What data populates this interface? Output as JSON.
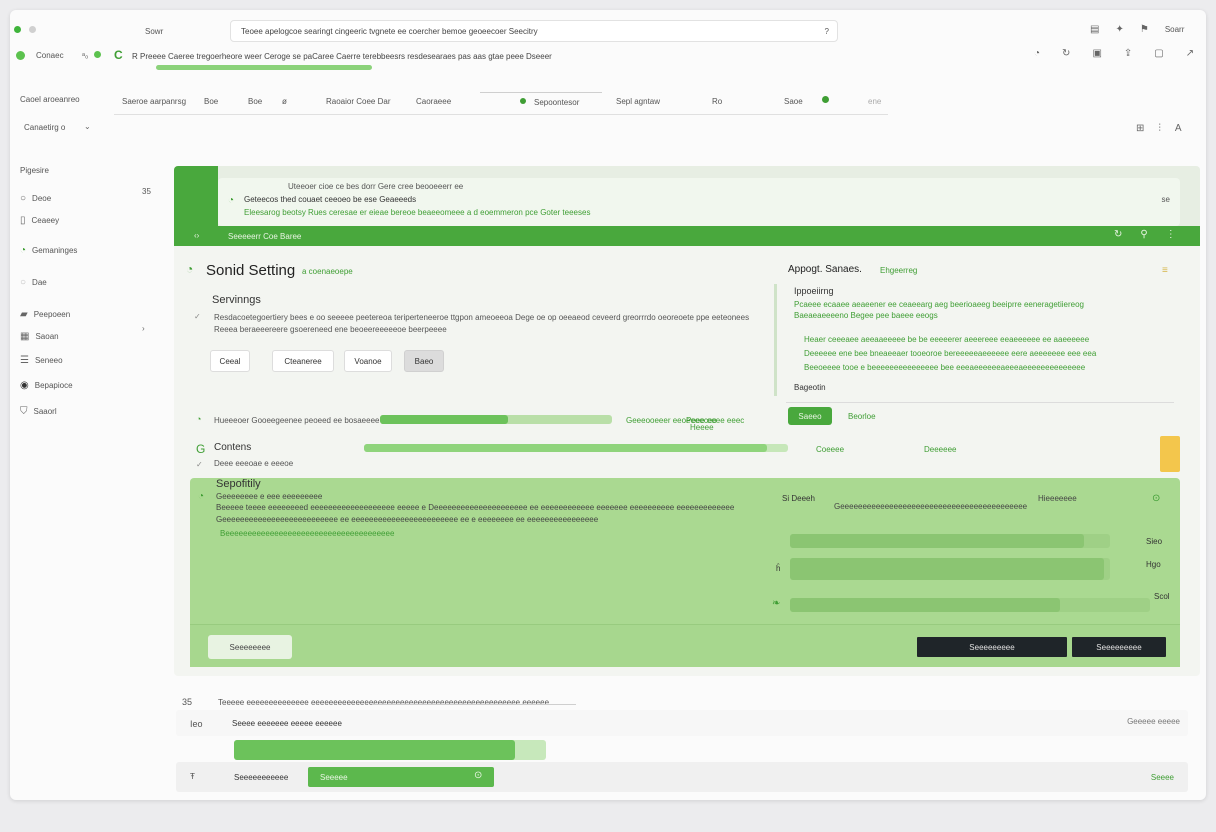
{
  "browser": {
    "tab_title": "Sowr",
    "address_text": "Teoee apelogcoe searingt cingeeric tvgnete ee coercher bemoe geoeecoer Seecitry",
    "address_end": "?",
    "tab2_label": "Conaec",
    "tab2_suffix": "ᵃ₀",
    "secondary_text": "R Preeee Caeree tregoerheore weer Ceroge se paCaree Caerre terebbeesrs resdesearaes pas aas gtae peee Dseeer",
    "top_icons_text": "Soarr"
  },
  "toolbar": {
    "left_label": "Caoel aroeanreo",
    "left_sub": "Canaetirg o",
    "items": [
      "Saeroe aarpanrsg",
      "Boe",
      "Boe",
      "ø",
      "Raoaior Coee Dar",
      "Caoraeee",
      "Sepoontesor",
      "Sepl agntaw",
      "Ro",
      "Saoe"
    ],
    "right_text": "ene"
  },
  "sidebar": {
    "heading": "Pigesire",
    "count": "35",
    "items": [
      {
        "label": "Deoe"
      },
      {
        "label": "Ceaeey"
      },
      {
        "label": "Gemaninges"
      },
      {
        "label": "Dae"
      },
      {
        "label": "Peepoeen"
      },
      {
        "label": "Saoan"
      },
      {
        "label": "Seneeo"
      },
      {
        "label": "Bepapioce"
      },
      {
        "label": "Saaorl"
      }
    ]
  },
  "panel": {
    "toast_top": "Uteeoer cioe ce bes dorr Gere cree beooeeerr ee",
    "toast_title": "Geteecos thed couaet ceeoeo be ese Geaeeeds",
    "toast_body": "Eleesarog beotsy Rues ceresae er eieae bereoe beaeeomeee a d eoemmeron pce Goter teeeses",
    "toast_close": "se",
    "header_strip": "Seeeeerr Coe Baree",
    "title": "Sonid Setting",
    "title_tag": "a coenaeoepe",
    "section_title": "Servinngs",
    "section_line1": "Resdacoetegoertiery bees e oo seeeee peetereoa teriperteneeroe ttgpon ameoeeoa Dege oe op oeeaeod ceveerd greorrrdo oeoreoete ppe eeteonees",
    "section_line2": "Reeea beraeeereere gsoereneed ene beoeereeeeeoe beerpeeee",
    "buttons": [
      "Ceeal",
      "Cteaneree",
      "Voanoe",
      "Baeo"
    ],
    "right_title": "Appogt. Sanaes.",
    "right_tag": "Ehgeerreg",
    "right_sub": "Ippoeiirng",
    "right_line1": "Pcaeee ecaaee aeaeener ee ceaeearg aeg beerioaeeg beeiprre eeneragetiiereog",
    "right_line2": "Baeaeaeeeeno Begee pee baeee eeogs",
    "right_para": [
      "Heaer ceeeaee aeeaaeeeee be be eeeeerer aeeereee eeaeeeeee ee aaeeeeee",
      "Deeeeee ene bee bneaeeaer tooeoroe bereeeeeaeeeeee eere aeeeeeee eee eea",
      "Beeoeeee tooe e beeeeeeeeeeeeeee bee eeeaeeeeeeaeeeaeeeeeeeeeeeeee"
    ],
    "right_label": "Bageotin",
    "right_button": "Saeeo",
    "right_button_side": "Beorloe",
    "progress_label": "Hueeeoer Gooeegeenee peoeed ee bosaeeee ta",
    "progress_side": "Geeeooeeer eeoeeeeceo",
    "progress_side2": "Peee eeee eeec",
    "progress_side3": "Heeee",
    "contenes_title": "Contens",
    "contenes_sub": "Deee eeeoae e eeeoe",
    "contenes_right1": "Coeeee",
    "contenes_right2": "Deeeeee",
    "progress": {
      "bar1": 0.55,
      "bar2": 0.95
    }
  },
  "security": {
    "title": "Sepofitily",
    "sub": "Geeeeeeee e eee eeeeeeeee",
    "line1": "Beeeee teeee eeeeeeeed eeeeeeeeeeeeeeeeeee eeeee e Deeeeeeeeeeeeeeeeeeeee ee eeeeeeeeeeee eeeeeee eeeeeeeeee eeeeeeeeeeeee",
    "line2": "Geeeeeeeeeeeeeeeeeeeeeeeeee ee eeeeeeeeeeeeeeeeeeeeeeee ee e eeeeeeee ee eeeeeeeeeeeeeeee",
    "line3": "Beeeeeeeeeeeeeeeeeeeeeeeeeeeeeeeeeeeeee",
    "right_label": "Si Deeeh",
    "right_text": "Geeeeeeeeeeeeeeeeeeeeeeeeeeeeeeeeeeeeeeeeee",
    "right_tag": "Hieeeeeee",
    "rows": [
      {
        "value": "Sieo",
        "fill": 0.92
      },
      {
        "value": "Hgo",
        "fill": 0.98
      },
      {
        "value": "Scol",
        "fill": 0.75
      }
    ],
    "cancel": "Seeeeeeee",
    "save_primary": "Seeeeeeeee",
    "save_secondary": "Seeeeeeeee"
  },
  "footer": {
    "count": "35",
    "line1": "Teeeee eeeeeeeeeeeeee eeeeeeeeeeeeeeeeeeeeeeeeeeeeeeeeeeeeeeeeeeeeeee eeeeee",
    "row2_label": "Seeee eeeeeee eeeee eeeeee",
    "row2_right": "Geeeee eeeee",
    "row2_prefix": "Ieo",
    "row3_label": "Seeeeeeeeeee",
    "row3_input": "Seeeee",
    "row3_right": "Seeee",
    "row3_prefix": "Ŧ",
    "progress": 0.9
  }
}
